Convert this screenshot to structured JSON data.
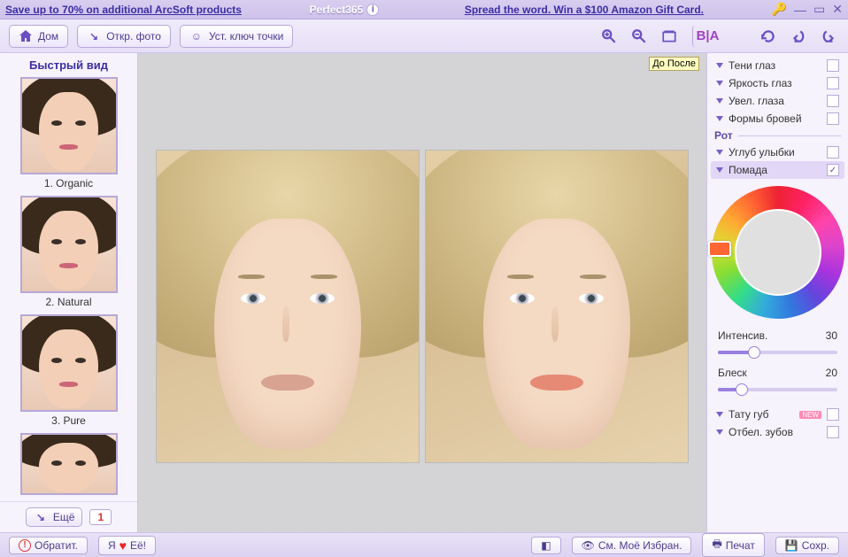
{
  "titlebar": {
    "promo_left": "Save up to 70% on additional ArcSoft products",
    "app_title": "Perfect365",
    "promo_right": "Spread the word. Win a $100 Amazon Gift Card."
  },
  "toolbar": {
    "home": "Дом",
    "open_photo": "Откр. фото",
    "set_keypoints": "Уст. ключ точки",
    "ba_label": "B|A"
  },
  "quickview": {
    "title": "Быстрый вид",
    "presets": [
      "1. Organic",
      "2. Natural",
      "3. Pure"
    ],
    "more": "Ещё",
    "badge": "1"
  },
  "canvas": {
    "compare_label": "До После"
  },
  "right": {
    "eye_options": [
      {
        "label": "Тени глаз",
        "checked": false
      },
      {
        "label": "Яркость глаз",
        "checked": false
      },
      {
        "label": "Увел. глаза",
        "checked": false
      },
      {
        "label": "Формы бровей",
        "checked": false
      }
    ],
    "mouth_cat": "Рот",
    "mouth_options": [
      {
        "label": "Углуб улыбки",
        "checked": false,
        "active": false
      },
      {
        "label": "Помада",
        "checked": true,
        "active": true
      }
    ],
    "intensity": {
      "label": "Интенсив.",
      "value": 30
    },
    "gloss": {
      "label": "Блеск",
      "value": 20
    },
    "tail_options": [
      {
        "label": "Тату губ",
        "checked": false,
        "new": true
      },
      {
        "label": "Отбел. зубов",
        "checked": false
      }
    ]
  },
  "bottom": {
    "feedback": "Обратит.",
    "i_pre": "Я",
    "i_post": "Её!",
    "favorites": "См. Моё Избран.",
    "print": "Печат",
    "save": "Сохр."
  }
}
